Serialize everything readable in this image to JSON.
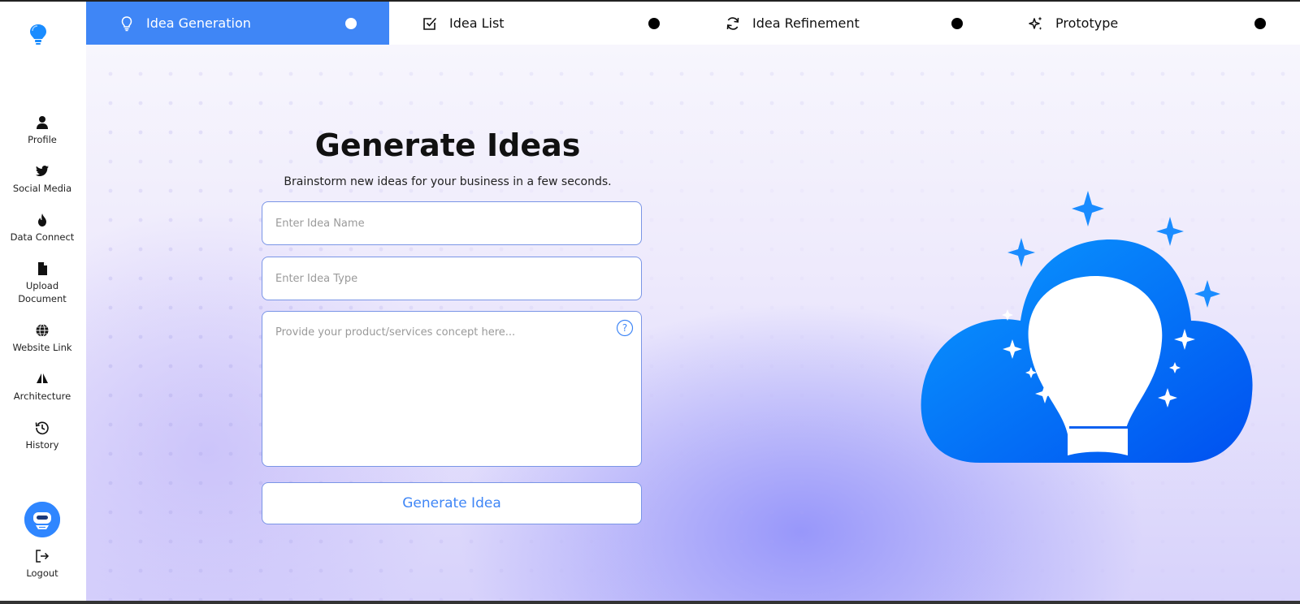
{
  "sidebar": {
    "items": [
      {
        "label": "Profile",
        "icon": "person-icon"
      },
      {
        "label": "Social Media",
        "icon": "twitter-icon"
      },
      {
        "label": "Data Connect",
        "icon": "flame-icon"
      },
      {
        "label": "Upload Document",
        "icon": "document-icon"
      },
      {
        "label": "Website Link",
        "icon": "globe-icon"
      },
      {
        "label": "Architecture",
        "icon": "architecture-icon"
      },
      {
        "label": "History",
        "icon": "history-icon"
      }
    ],
    "logout_label": "Logout"
  },
  "tabs": [
    {
      "label": "Idea Generation",
      "icon": "lightbulb-icon",
      "active": true
    },
    {
      "label": "Idea List",
      "icon": "checkbox-icon",
      "active": false
    },
    {
      "label": "Idea Refinement",
      "icon": "refresh-icon",
      "active": false
    },
    {
      "label": "Prototype",
      "icon": "sparkles-icon",
      "active": false
    }
  ],
  "main": {
    "title": "Generate Ideas",
    "subtitle": "Brainstorm new ideas for your business in a few seconds.",
    "idea_name_placeholder": "Enter Idea Name",
    "idea_type_placeholder": "Enter Idea Type",
    "concept_placeholder": "Provide your product/services concept here...",
    "generate_button": "Generate Idea"
  },
  "colors": {
    "accent": "#3f86f6",
    "bulb_blue": "#0a7cff",
    "field_border": "#7a95e6"
  }
}
